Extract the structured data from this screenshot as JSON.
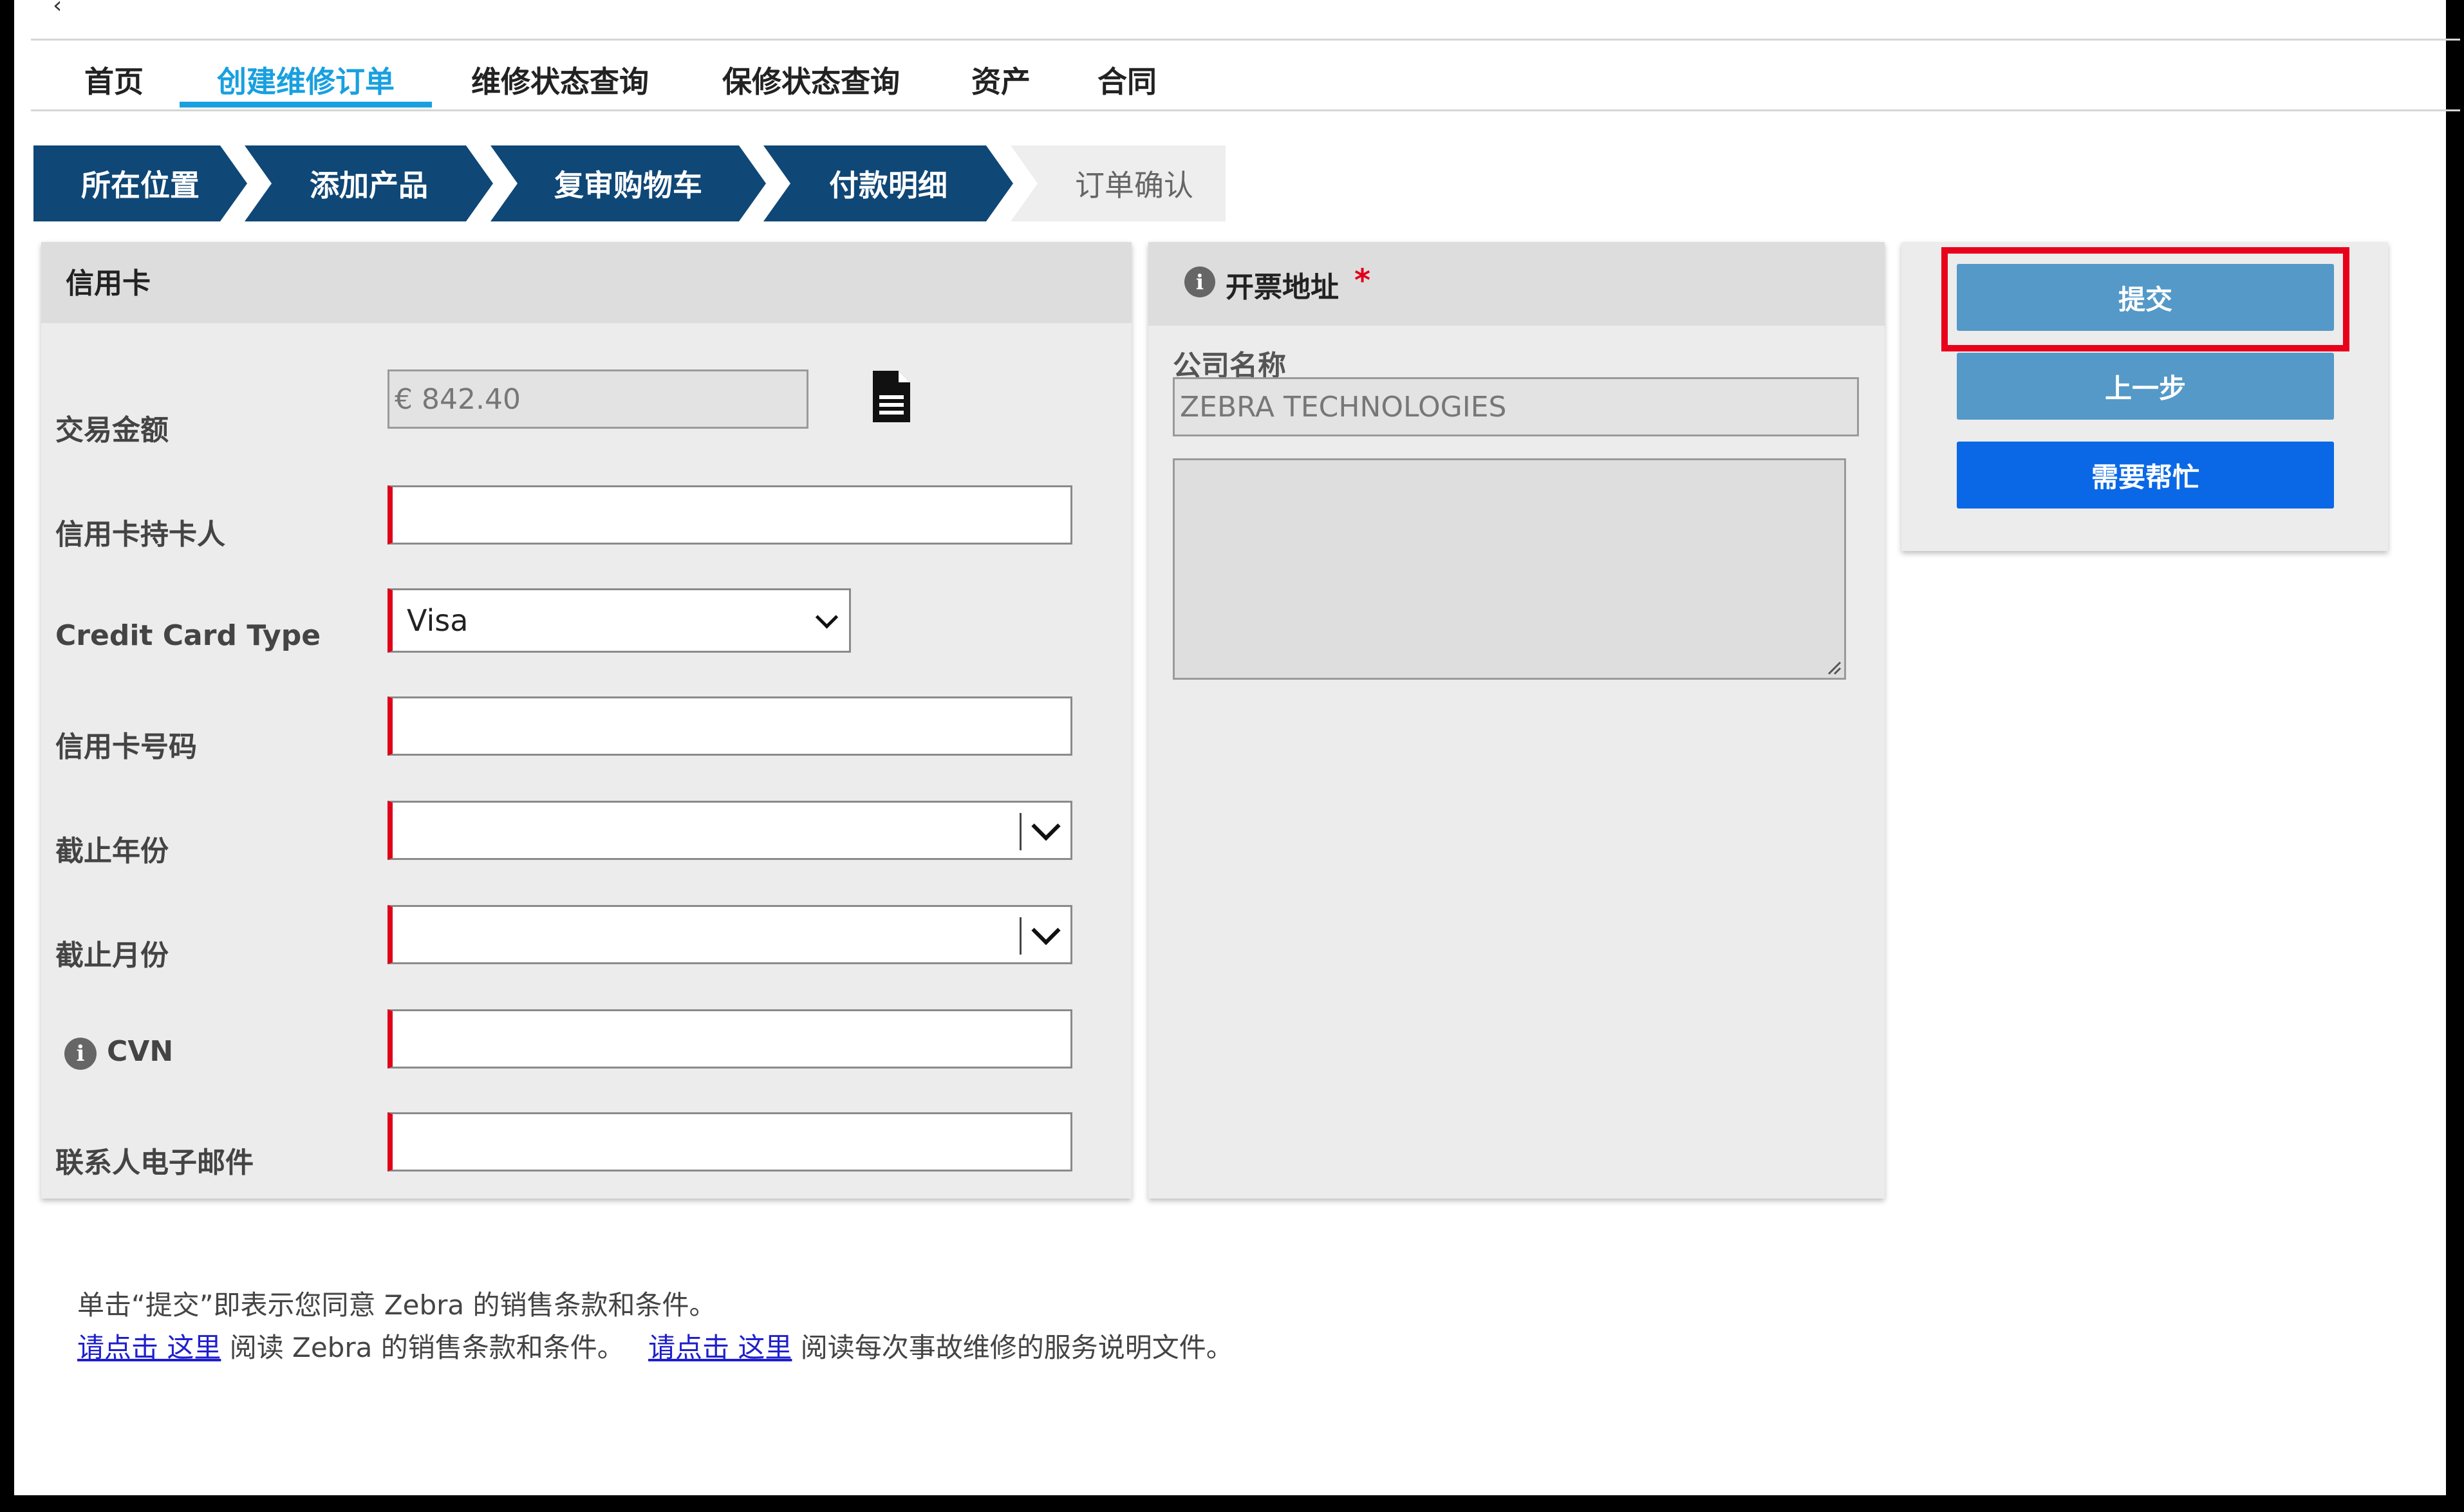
{
  "nav": {
    "items": [
      "首页",
      "创建维修订单",
      "维修状态查询",
      "保修状态查询",
      "资产",
      "合同"
    ],
    "active_index": 1
  },
  "steps": [
    "所在位置",
    "添加产品",
    "复审购物车",
    "付款明细",
    "订单确认"
  ],
  "credit_card": {
    "title": "信用卡",
    "amount_label": "交易金额",
    "amount_value": "€ 842.40",
    "holder_label": "信用卡持卡人",
    "holder_value": "",
    "type_label": "Credit Card Type",
    "type_value": "Visa",
    "number_label": "信用卡号码",
    "number_value": "",
    "exp_year_label": "截止年份",
    "exp_year_value": "",
    "exp_month_label": "截止月份",
    "exp_month_value": "",
    "cvn_label": "CVN",
    "cvn_value": "",
    "email_label": "联系人电子邮件",
    "email_value": ""
  },
  "billing": {
    "title": "开票地址",
    "required_mark": "*",
    "company_label": "公司名称",
    "company_value": "ZEBRA TECHNOLOGIES",
    "address_value": ""
  },
  "actions": {
    "submit": "提交",
    "previous": "上一步",
    "help": "需要帮忙"
  },
  "footer": {
    "line1": "单击“提交”即表示您同意 Zebra 的销售条款和条件。",
    "link1": "请点击 这里",
    "text1": " 阅读 Zebra 的销售条款和条件。",
    "link2": "请点击 这里",
    "text2": " 阅读每次事故维修的服务说明文件。"
  },
  "colors": {
    "accent": "#18a0e0",
    "step_active": "#0f4776",
    "required": "#e0001a",
    "highlight": "#e8001c",
    "help_button": "#0a68e6",
    "action_button": "#5499c7"
  }
}
